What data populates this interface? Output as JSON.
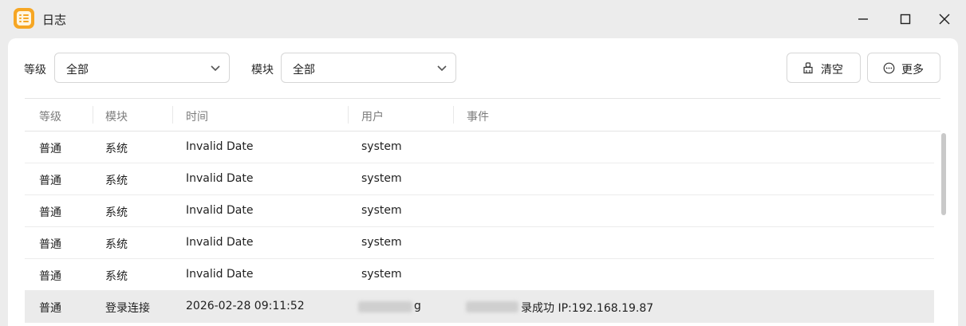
{
  "window": {
    "title": "日志"
  },
  "filters": {
    "level_label": "等级",
    "level_value": "全部",
    "module_label": "模块",
    "module_value": "全部"
  },
  "actions": {
    "clear_label": "清空",
    "more_label": "更多"
  },
  "table": {
    "headers": [
      "等级",
      "模块",
      "时间",
      "用户",
      "事件"
    ],
    "rows": [
      {
        "level": "普通",
        "module": "系统",
        "time": "Invalid Date",
        "user": "system",
        "event": ""
      },
      {
        "level": "普通",
        "module": "系统",
        "time": "Invalid Date",
        "user": "system",
        "event": ""
      },
      {
        "level": "普通",
        "module": "系统",
        "time": "Invalid Date",
        "user": "system",
        "event": ""
      },
      {
        "level": "普通",
        "module": "系统",
        "time": "Invalid Date",
        "user": "system",
        "event": ""
      },
      {
        "level": "普通",
        "module": "系统",
        "time": "Invalid Date",
        "user": "system",
        "event": ""
      },
      {
        "level": "普通",
        "module": "登录连接",
        "time": "2026-02-28 09:11:52",
        "user": "g",
        "event": "录成功 IP:192.168.19.87"
      }
    ]
  },
  "colors": {
    "accent": "#f6a623",
    "selected_row": "#ebebeb"
  },
  "icons": {
    "app": "list-icon",
    "minimize": "minimize-icon",
    "maximize": "maximize-icon",
    "close": "close-icon",
    "clear": "broom-icon",
    "more": "more-circle-icon",
    "dropdown": "chevron-down-icon"
  }
}
